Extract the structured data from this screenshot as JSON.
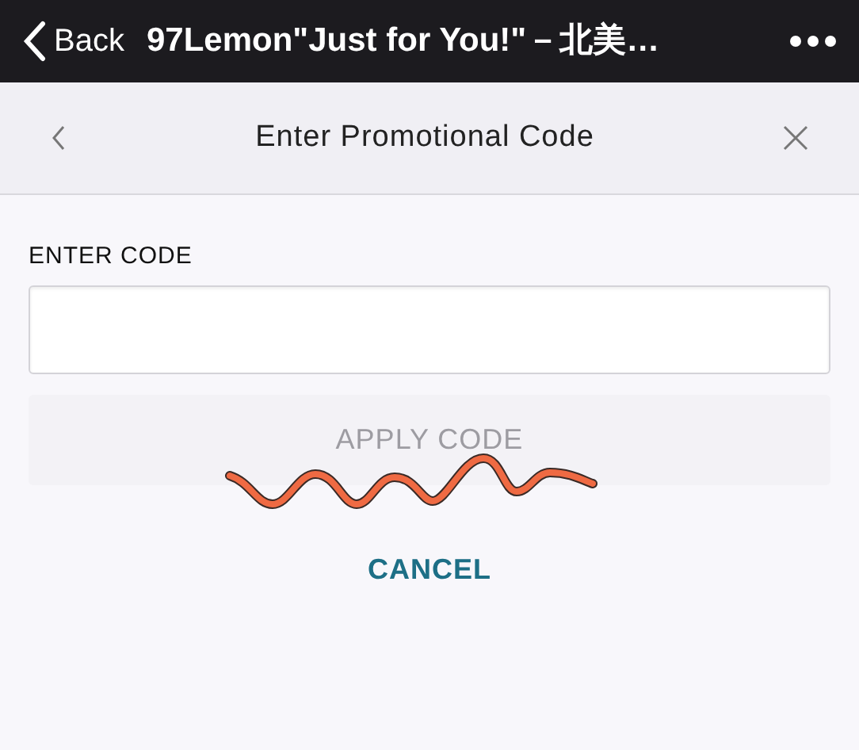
{
  "top_bar": {
    "back_label": "Back",
    "title": "97Lemon\"Just for You!\"－北美…"
  },
  "dialog": {
    "title": "Enter Promotional Code"
  },
  "form": {
    "label": "ENTER CODE"
  },
  "buttons": [
    {
      "kind": "primary",
      "label": "APPLY CODE",
      "disabled": true
    },
    {
      "kind": "link",
      "label": "CANCEL",
      "disabled": false
    }
  ]
}
